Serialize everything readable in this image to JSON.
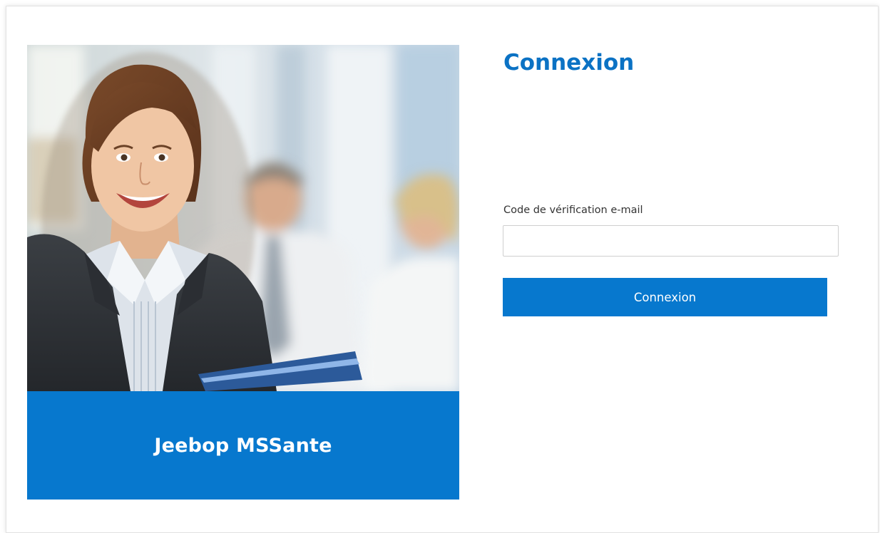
{
  "login": {
    "title": "Connexion",
    "code_label": "Code de vérification e-mail",
    "code_value": "",
    "code_placeholder": "",
    "submit_label": "Connexion"
  },
  "hero": {
    "brand_name": "Jeebop MSSante",
    "photo_alt": "Jeebop MSSante"
  },
  "colors": {
    "brand_blue": "#0778ce",
    "title_blue": "#0b72c4",
    "label_text": "#333333",
    "input_border": "#cfcfcf"
  }
}
